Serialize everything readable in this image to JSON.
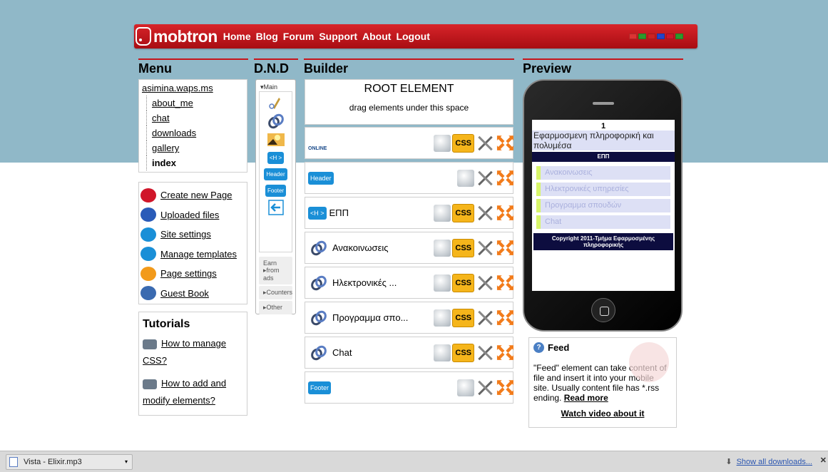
{
  "header": {
    "logo": "mobtron",
    "nav": [
      "Home",
      "Blog",
      "Forum",
      "Support",
      "About",
      "Logout"
    ],
    "flag_colors": [
      "#d33",
      "#2c9a2c",
      "#c22",
      "#2244cc",
      "#d0162a",
      "#2c9a2c"
    ]
  },
  "columns": {
    "menu": "Menu",
    "dnd": "D.N.D",
    "builder": "Builder",
    "preview": "Preview"
  },
  "menu": {
    "root": "asimina.waps.ms",
    "pages": [
      "about_me",
      "chat",
      "downloads",
      "gallery",
      "index"
    ]
  },
  "actions": [
    {
      "label": "Create new Page",
      "icon": "new-badge-icon",
      "color": "#d0162a"
    },
    {
      "label": "Uploaded files",
      "icon": "upload-icon",
      "color": "#2a5bb8"
    },
    {
      "label": "Site settings",
      "icon": "settings-icon",
      "color": "#1a8fd7"
    },
    {
      "label": "Manage templates",
      "icon": "back-arrow-icon",
      "color": "#1a8fd7"
    },
    {
      "label": "Page settings",
      "icon": "page-gear-icon",
      "color": "#f29a1a"
    },
    {
      "label": " Guest Book",
      "icon": "guestbook-icon",
      "color": "#3a6ab0"
    }
  ],
  "tutorials": {
    "title": "Tutorials",
    "items": [
      "How to manage CSS?",
      "How to add and modify elements?"
    ]
  },
  "dnd": {
    "main_tab": "▾Main",
    "buttons": [
      "<H >",
      "Header",
      "Footer"
    ],
    "sections": [
      "Earn ▸from ads",
      "▸Counters",
      "▸Other"
    ]
  },
  "builder": {
    "root_title": "ROOT ELEMENT",
    "root_sub": "drag elements under this space",
    "rows": [
      {
        "label": "",
        "kind": "online",
        "css": true
      },
      {
        "label": "",
        "kind": "header-btn",
        "btn": "Header",
        "css": false
      },
      {
        "label": "ΕΠΠ",
        "kind": "h-btn",
        "btn": "<H >",
        "css": true
      },
      {
        "label": "Ανακοινωσεις",
        "kind": "link",
        "css": true
      },
      {
        "label": "Ηλεκτρονικές ...",
        "kind": "link",
        "css": true
      },
      {
        "label": "Προγραμμα σπο...",
        "kind": "link",
        "css": true
      },
      {
        "label": "Chat",
        "kind": "link",
        "css": true
      },
      {
        "label": "",
        "kind": "footer-btn",
        "btn": "Footer",
        "css": false
      }
    ],
    "online_label": "ONLINE",
    "css_label": "CSS"
  },
  "preview": {
    "page_num": "1",
    "title": "Εφαρμοσμενη πληροφορική και πολυμέσα",
    "bar": "ΕΠΠ",
    "items": [
      "Ανακοινωσεις",
      "Ηλεκτρονικές υπηρεσίες",
      "Προγραμμα σπουδών",
      "Chat"
    ],
    "copyright": "Copyright 2011-Τμήμα Εφαρμοσμένης πληροφορικής"
  },
  "feed": {
    "title": "Feed",
    "text": "\"Feed\" element can take content of file and insert it into your mobile site. Usually content file has *.rss ending.",
    "read_more": "Read more",
    "video": "Watch video about it"
  },
  "downloads": {
    "file": "Vista - Elixir.mp3",
    "show_all": "Show all downloads...",
    "close": "✕"
  }
}
